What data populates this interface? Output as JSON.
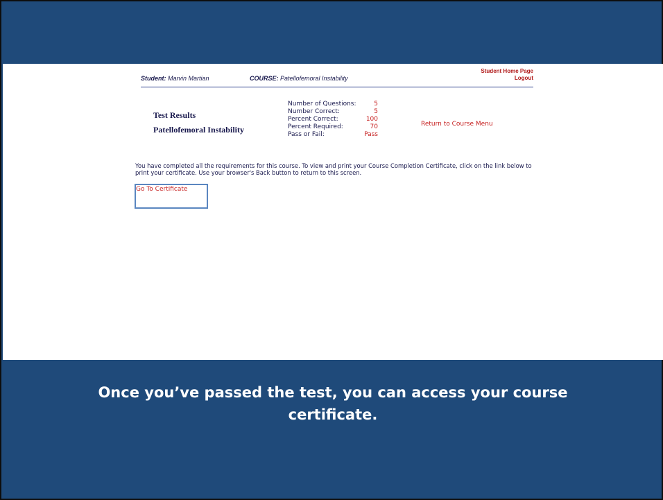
{
  "header": {
    "student_label": "Student:",
    "student_name": "Marvin Martian",
    "course_label": "COURSE:",
    "course_name": "Patellofemoral Instability",
    "home_link": "Student Home Page",
    "logout_link": "Logout"
  },
  "results": {
    "title": "Test Results",
    "course_title": "Patellofemoral Instability",
    "stats": [
      {
        "label": "Number of Questions:",
        "value": "5"
      },
      {
        "label": "Number Correct:",
        "value": "5"
      },
      {
        "label": "Percent Correct:",
        "value": "100"
      },
      {
        "label": "Percent Required:",
        "value": "70"
      },
      {
        "label": "Pass or Fail:",
        "value": "Pass"
      }
    ],
    "return_link": "Return to Course Menu"
  },
  "message": {
    "text": "You have completed all the requirements for this course. To view and print your Course Completion Certificate, click on the link below to print your certificate. Use your browser's Back button to return to this screen.",
    "certificate_link": "Go To Certificate"
  },
  "caption": {
    "line1": "Once you’ve passed the test, you can access your course",
    "line2": "certificate."
  },
  "colors": {
    "slide_background": "#1f4a7a",
    "link_red": "#c62020",
    "text_navy": "#1a1a4e",
    "highlight_box": "#5a86c0"
  }
}
